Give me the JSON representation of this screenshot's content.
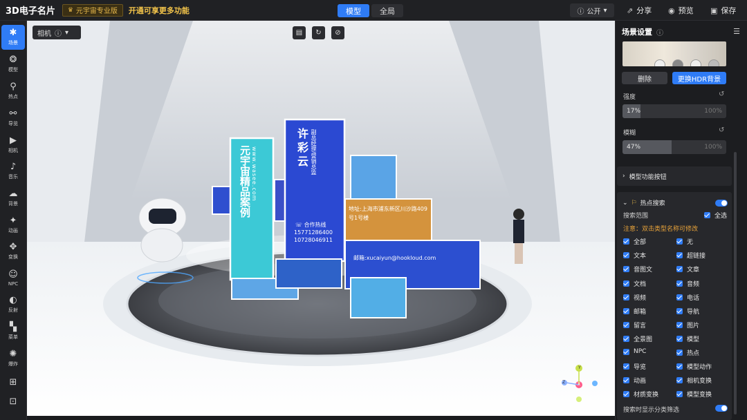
{
  "topbar": {
    "app_title": "3D电子名片",
    "pro_badge": "元宇宙专业版",
    "upgrade_link": "开通可享更多功能",
    "tabs": [
      {
        "label": "模型"
      },
      {
        "label": "全局"
      }
    ],
    "public_label": "公开",
    "share_label": "分享",
    "preview_label": "预览",
    "save_label": "保存"
  },
  "sidebar": {
    "items": [
      {
        "label": "场景",
        "icon": "scene-icon"
      },
      {
        "label": "模型",
        "icon": "model-icon"
      },
      {
        "label": "热点",
        "icon": "hotspot-icon"
      },
      {
        "label": "导览",
        "icon": "tour-icon"
      },
      {
        "label": "相机",
        "icon": "camera-icon"
      },
      {
        "label": "音乐",
        "icon": "music-icon"
      },
      {
        "label": "背景",
        "icon": "background-icon"
      },
      {
        "label": "动画",
        "icon": "animation-icon"
      },
      {
        "label": "变换",
        "icon": "transform-icon"
      },
      {
        "label": "NPC",
        "icon": "npc-icon"
      },
      {
        "label": "反射",
        "icon": "reflection-icon"
      },
      {
        "label": "菜单",
        "icon": "menu-icon"
      },
      {
        "label": "爆炸",
        "icon": "explode-icon"
      }
    ]
  },
  "viewport": {
    "camera_label": "相机",
    "scene": {
      "board1": "元宇宙精品案例",
      "url": "www.wasee.com",
      "board2_name": "许彩云",
      "board2_title": "副总经理/营销总监",
      "hotline_label": "合作热线",
      "phone1": "15771286400",
      "phone2": "10728046911",
      "address": "地址:上海市浦东新区川沙路409号1号楼",
      "email": "邮箱:xucaiyun@hookloud.com"
    },
    "axis": {
      "x": "X",
      "y": "Y",
      "z": "Z"
    }
  },
  "panel": {
    "title": "场景设置",
    "delete_label": "删除",
    "replace_hdr_label": "更换HDR背景",
    "intensity_label": "强度",
    "intensity_value": "17%",
    "intensity_fraction": 0.17,
    "intensity_max": "100%",
    "blur_label": "模糊",
    "blur_value": "47%",
    "blur_fraction": 0.47,
    "blur_max": "100%",
    "model_buttons_label": "模型功能按钮",
    "hotspot_search_label": "热点搜索",
    "search_scope_label": "搜索范围",
    "select_all_label": "全选",
    "note": "注意：双击类型名称可修改",
    "options_left": [
      "全部",
      "文本",
      "音图文",
      "文档",
      "视频",
      "邮箱",
      "留言",
      "全景图",
      "NPC",
      "导览",
      "动画",
      "材质变换"
    ],
    "options_right": [
      "无",
      "超链接",
      "文章",
      "音频",
      "电话",
      "导航",
      "图片",
      "模型",
      "热点",
      "模型动作",
      "相机变换",
      "模型变换"
    ],
    "footer_label": "搜索时显示分类筛选"
  }
}
